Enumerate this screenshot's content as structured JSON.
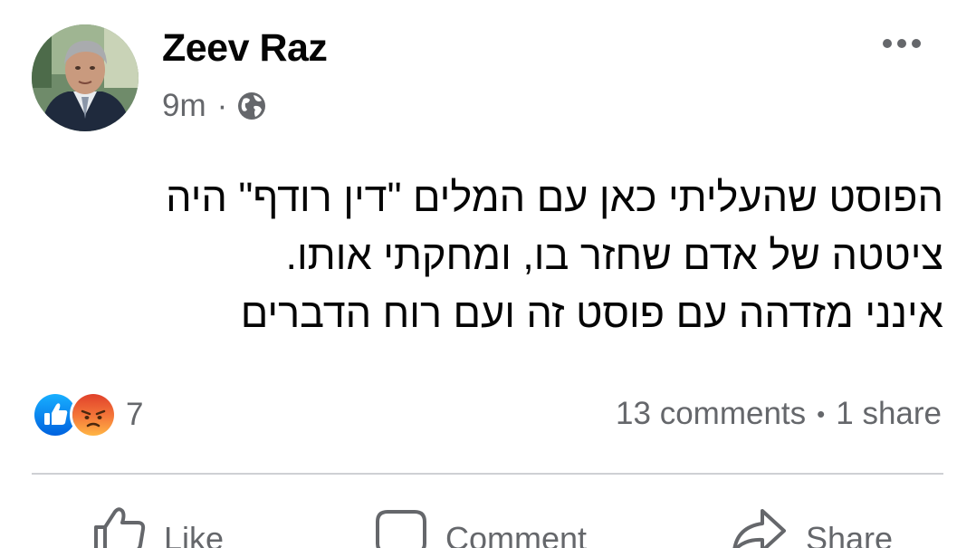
{
  "post": {
    "author": "Zeev Raz",
    "timestamp": "9m",
    "meta_separator": "·",
    "audience_icon": "globe-icon",
    "more_icon": "more-options-icon",
    "text_lines": [
      "הפוסט שהעליתי כאן עם המלים \"דין רודף\" היה",
      "ציטטה של אדם שחזר בו, ומחקתי אותו.",
      "אינני מזדהה עם פוסט זה ועם רוח הדברים"
    ]
  },
  "reactions": {
    "icons": [
      "like-icon",
      "angry-icon"
    ],
    "count": "7"
  },
  "engagement": {
    "comments": "13 comments",
    "separator": "•",
    "shares": "1 share"
  },
  "actions": {
    "like": "Like",
    "comment": "Comment",
    "share": "Share"
  },
  "colors": {
    "like_blue": "#1877f2",
    "angry_orange": "#f5793a",
    "secondary_text": "#65676b",
    "divider": "#ced0d4"
  }
}
